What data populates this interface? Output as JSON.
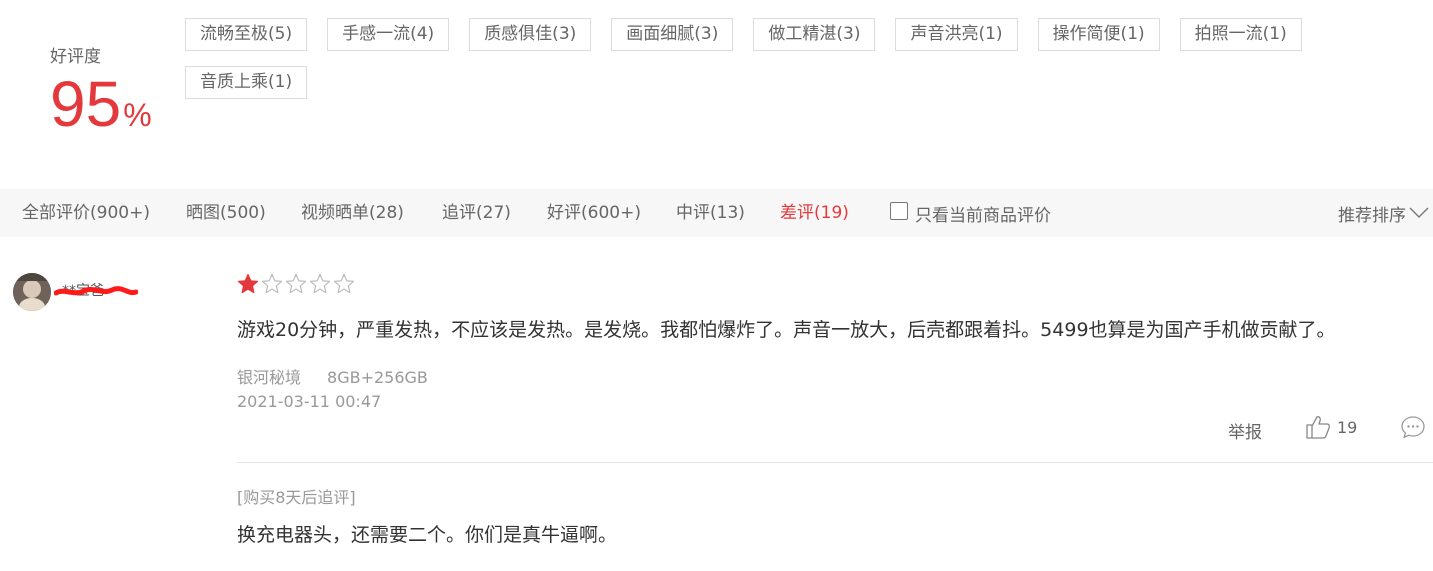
{
  "summary": {
    "label": "好评度",
    "value": "95",
    "unit": "%",
    "tags": [
      "流畅至极(5)",
      "手感一流(4)",
      "质感俱佳(3)",
      "画面细腻(3)",
      "做工精湛(3)",
      "声音洪亮(1)",
      "操作简便(1)",
      "拍照一流(1)",
      "音质上乘(1)"
    ]
  },
  "filters": {
    "tabs": [
      "全部评价(900+)",
      "晒图(500)",
      "视频晒单(28)",
      "追评(27)",
      "好评(600+)",
      "中评(13)",
      "差评(19)"
    ],
    "active_tab": "差评(19)",
    "only_current_label": "只看当前商品评价",
    "only_current_checked": false,
    "sort_label": "推荐排序",
    "sort_icon": "chevron-down-icon"
  },
  "review": {
    "username": "**宝爸",
    "username_redacted": true,
    "rating": 1,
    "rating_max": 5,
    "text": "游戏20分钟，严重发热，不应该是发热。是发烧。我都怕爆炸了。声音一放大，后壳都跟着抖。5499也算是为国产手机做贡献了。",
    "product_color": "银河秘境",
    "product_spec": "8GB+256GB",
    "date": "2021-03-11 00:47",
    "report_label": "举报",
    "like_count": "19",
    "append_label": "[购买8天后追评]",
    "append_text": "换充电器头，还需要二个。你们是真牛逼啊。"
  },
  "colors": {
    "accent": "#e4393c",
    "text_muted": "#999999",
    "text_secondary": "#666666",
    "border": "#dcdcdc",
    "bar_bg": "#f7f7f7"
  },
  "icons": [
    "star-filled-icon",
    "star-empty-icon",
    "thumbs-up-icon",
    "comment-icon",
    "chevron-down-icon",
    "checkbox-icon"
  ]
}
